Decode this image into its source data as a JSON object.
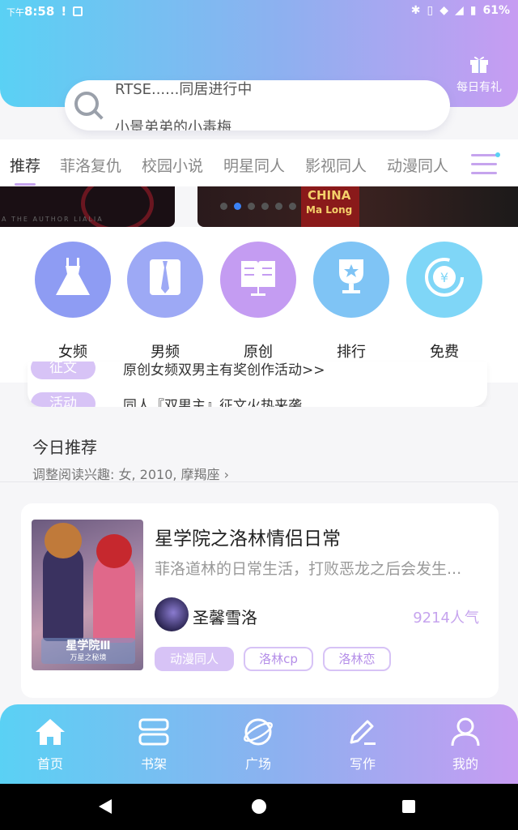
{
  "status_bar": {
    "ampm": "下午",
    "time": "8:58",
    "alert": "!",
    "battery": "61%"
  },
  "header": {
    "gift_label": "每日有礼"
  },
  "search": {
    "line1": "RTSE......同居进行中",
    "line2": "小景弟弟的小毒梅"
  },
  "tabs": [
    {
      "label": "推荐"
    },
    {
      "label": "菲洛复仇"
    },
    {
      "label": "校园小说"
    },
    {
      "label": "明星同人"
    },
    {
      "label": "影视同人"
    },
    {
      "label": "动漫同人"
    }
  ],
  "banner": {
    "left_caption": "A  THE  AUTHOR  LIALIA",
    "right_line1": "CHINA",
    "right_line2": "Ma Long",
    "active_dot": 1
  },
  "categories": [
    {
      "label": "女频",
      "icon": "dress-icon",
      "color": "#8e9cf3"
    },
    {
      "label": "男频",
      "icon": "shirt-tie-icon",
      "color": "#9da9f5"
    },
    {
      "label": "原创",
      "icon": "open-book-icon",
      "color": "#c49cf2"
    },
    {
      "label": "排行",
      "icon": "trophy-icon",
      "color": "#7fc4f5"
    },
    {
      "label": "免费",
      "icon": "yen-coin-icon",
      "color": "#7fd6f7"
    }
  ],
  "notices": [
    {
      "tag": "征文",
      "text": "原创女频双男主有奖创作活动>>"
    },
    {
      "tag": "活动",
      "text": "同人『双男主』征文火热来袭"
    }
  ],
  "section": {
    "title": "今日推荐",
    "subtitle": "调整阅读兴趣: 女, 2010, 摩羯座"
  },
  "book": {
    "title": "星学院之洛林情侣日常",
    "description": "菲洛道林的日常生活，打败恶龙之后会发生...",
    "author": "圣馨雪洛",
    "popularity": "9214人气",
    "cover_title": "星学院Ⅲ",
    "cover_subtitle": "万星之秘境",
    "tags": [
      "动漫同人",
      "洛林cp",
      "洛林恋"
    ]
  },
  "bottom_nav": [
    {
      "label": "首页",
      "icon": "home-icon"
    },
    {
      "label": "书架",
      "icon": "bookshelf-icon"
    },
    {
      "label": "广场",
      "icon": "planet-icon"
    },
    {
      "label": "写作",
      "icon": "pen-icon"
    },
    {
      "label": "我的",
      "icon": "user-icon"
    }
  ],
  "colors": {
    "accent": "#c6a4ee",
    "gradient_start": "#5ad1f4",
    "gradient_end": "#c79cf2"
  }
}
